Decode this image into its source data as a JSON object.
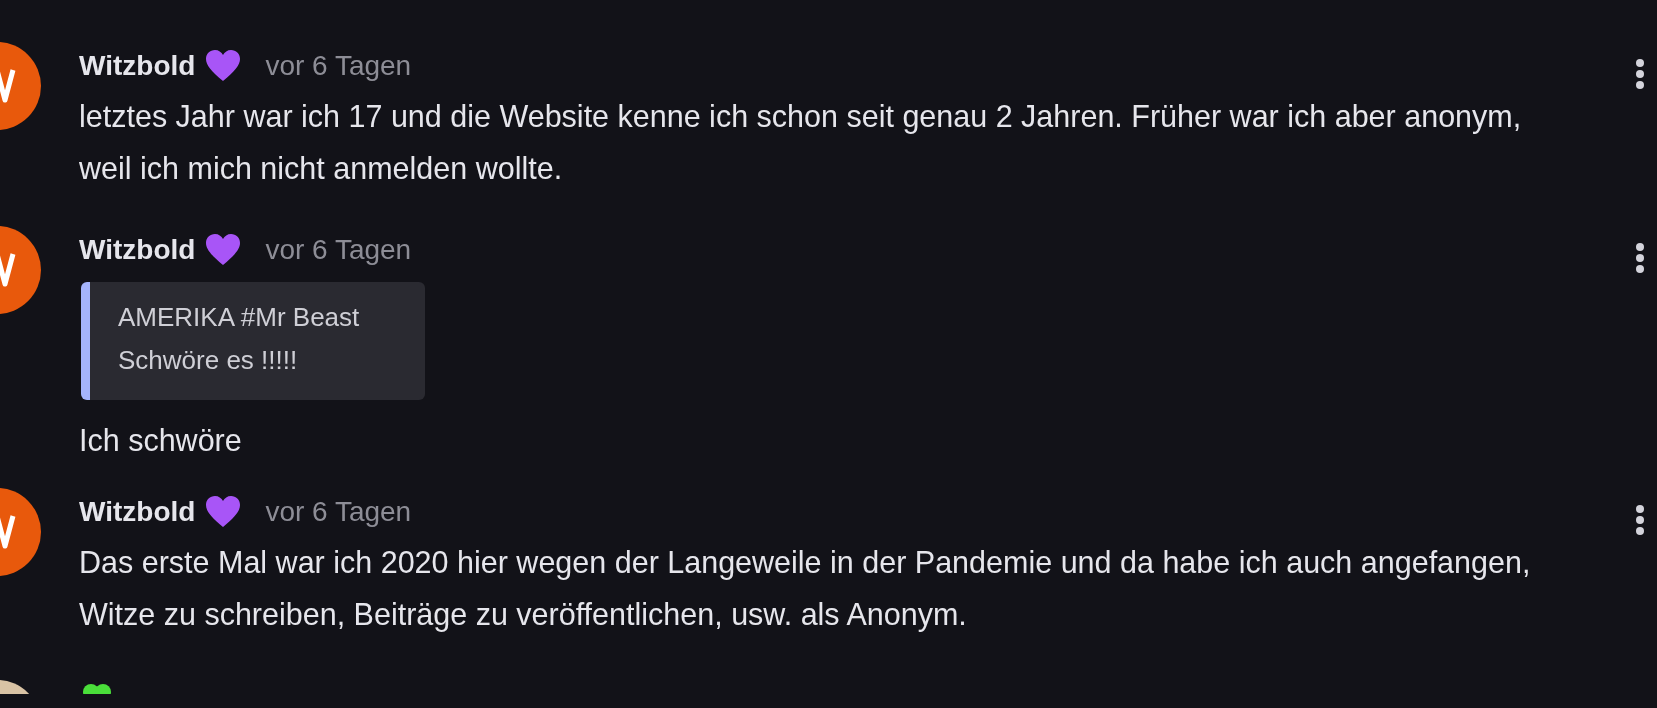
{
  "comments": [
    {
      "author": "Witzbold",
      "kind": "heart",
      "color": "#e8590c",
      "time": "vor 6 Tagen",
      "text": "letztes Jahr war ich 17 und die Website kenne ich schon seit genau 2 Jahren. Früher war ich aber anonym, weil ich mich nicht anmelden wollte."
    },
    {
      "author": "Witzbold",
      "kind": "heart",
      "color": "#e8590c",
      "time": "vor 6 Tagen",
      "quote": [
        "AMERIKA #Mr Beast",
        "Schwöre es !!!!!"
      ],
      "text": "Ich schwöre"
    },
    {
      "author": "Witzbold",
      "kind": "heart",
      "color": "#e8590c",
      "time": "vor 6 Tagen",
      "text": "Das erste Mal war ich 2020 hier wegen der Langeweile in der Pandemie und da habe ich auch angefangen, Witze zu schreiben, Beiträge zu veröffentlichen, usw. als Anonym."
    },
    {
      "kind": "clover",
      "color": "#d9c3a5"
    }
  ]
}
